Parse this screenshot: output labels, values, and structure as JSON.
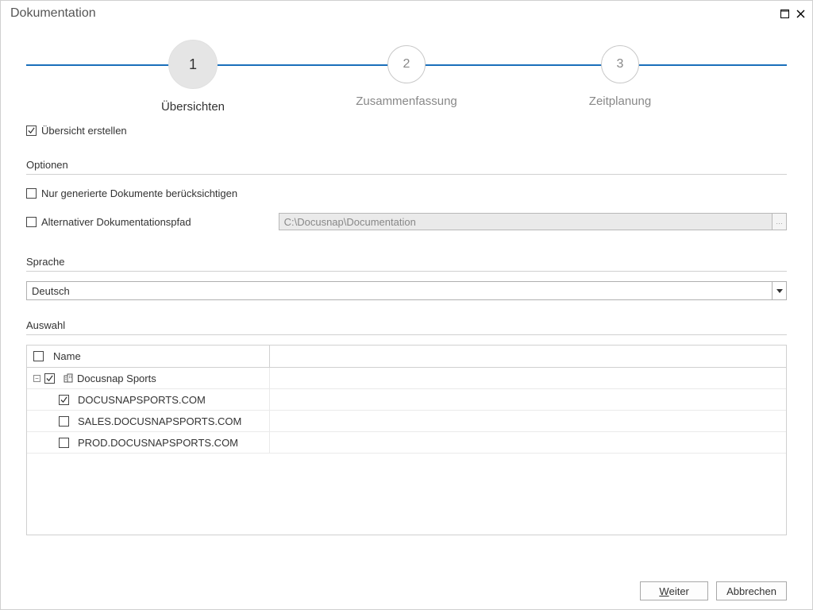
{
  "window": {
    "title": "Dokumentation"
  },
  "steps": {
    "s1": {
      "num": "1",
      "label": "Übersichten"
    },
    "s2": {
      "num": "2",
      "label": "Zusammenfassung"
    },
    "s3": {
      "num": "3",
      "label": "Zeitplanung"
    }
  },
  "create_overview": {
    "label": "Übersicht erstellen"
  },
  "sections": {
    "options": "Optionen",
    "language": "Sprache",
    "selection": "Auswahl"
  },
  "options": {
    "only_generated": "Nur generierte Dokumente berücksichtigen",
    "alt_path_label": "Alternativer Dokumentationspfad",
    "alt_path_value": "C:\\Docusnap\\Documentation"
  },
  "language": {
    "selected": "Deutsch"
  },
  "tree": {
    "header": "Name",
    "root": "Docusnap Sports",
    "items": [
      "DOCUSNAPSPORTS.COM",
      "SALES.DOCUSNAPSPORTS.COM",
      "PROD.DOCUSNAPSPORTS.COM"
    ]
  },
  "footer": {
    "next_u": "W",
    "next_rest": "eiter",
    "cancel": "Abbrechen"
  }
}
